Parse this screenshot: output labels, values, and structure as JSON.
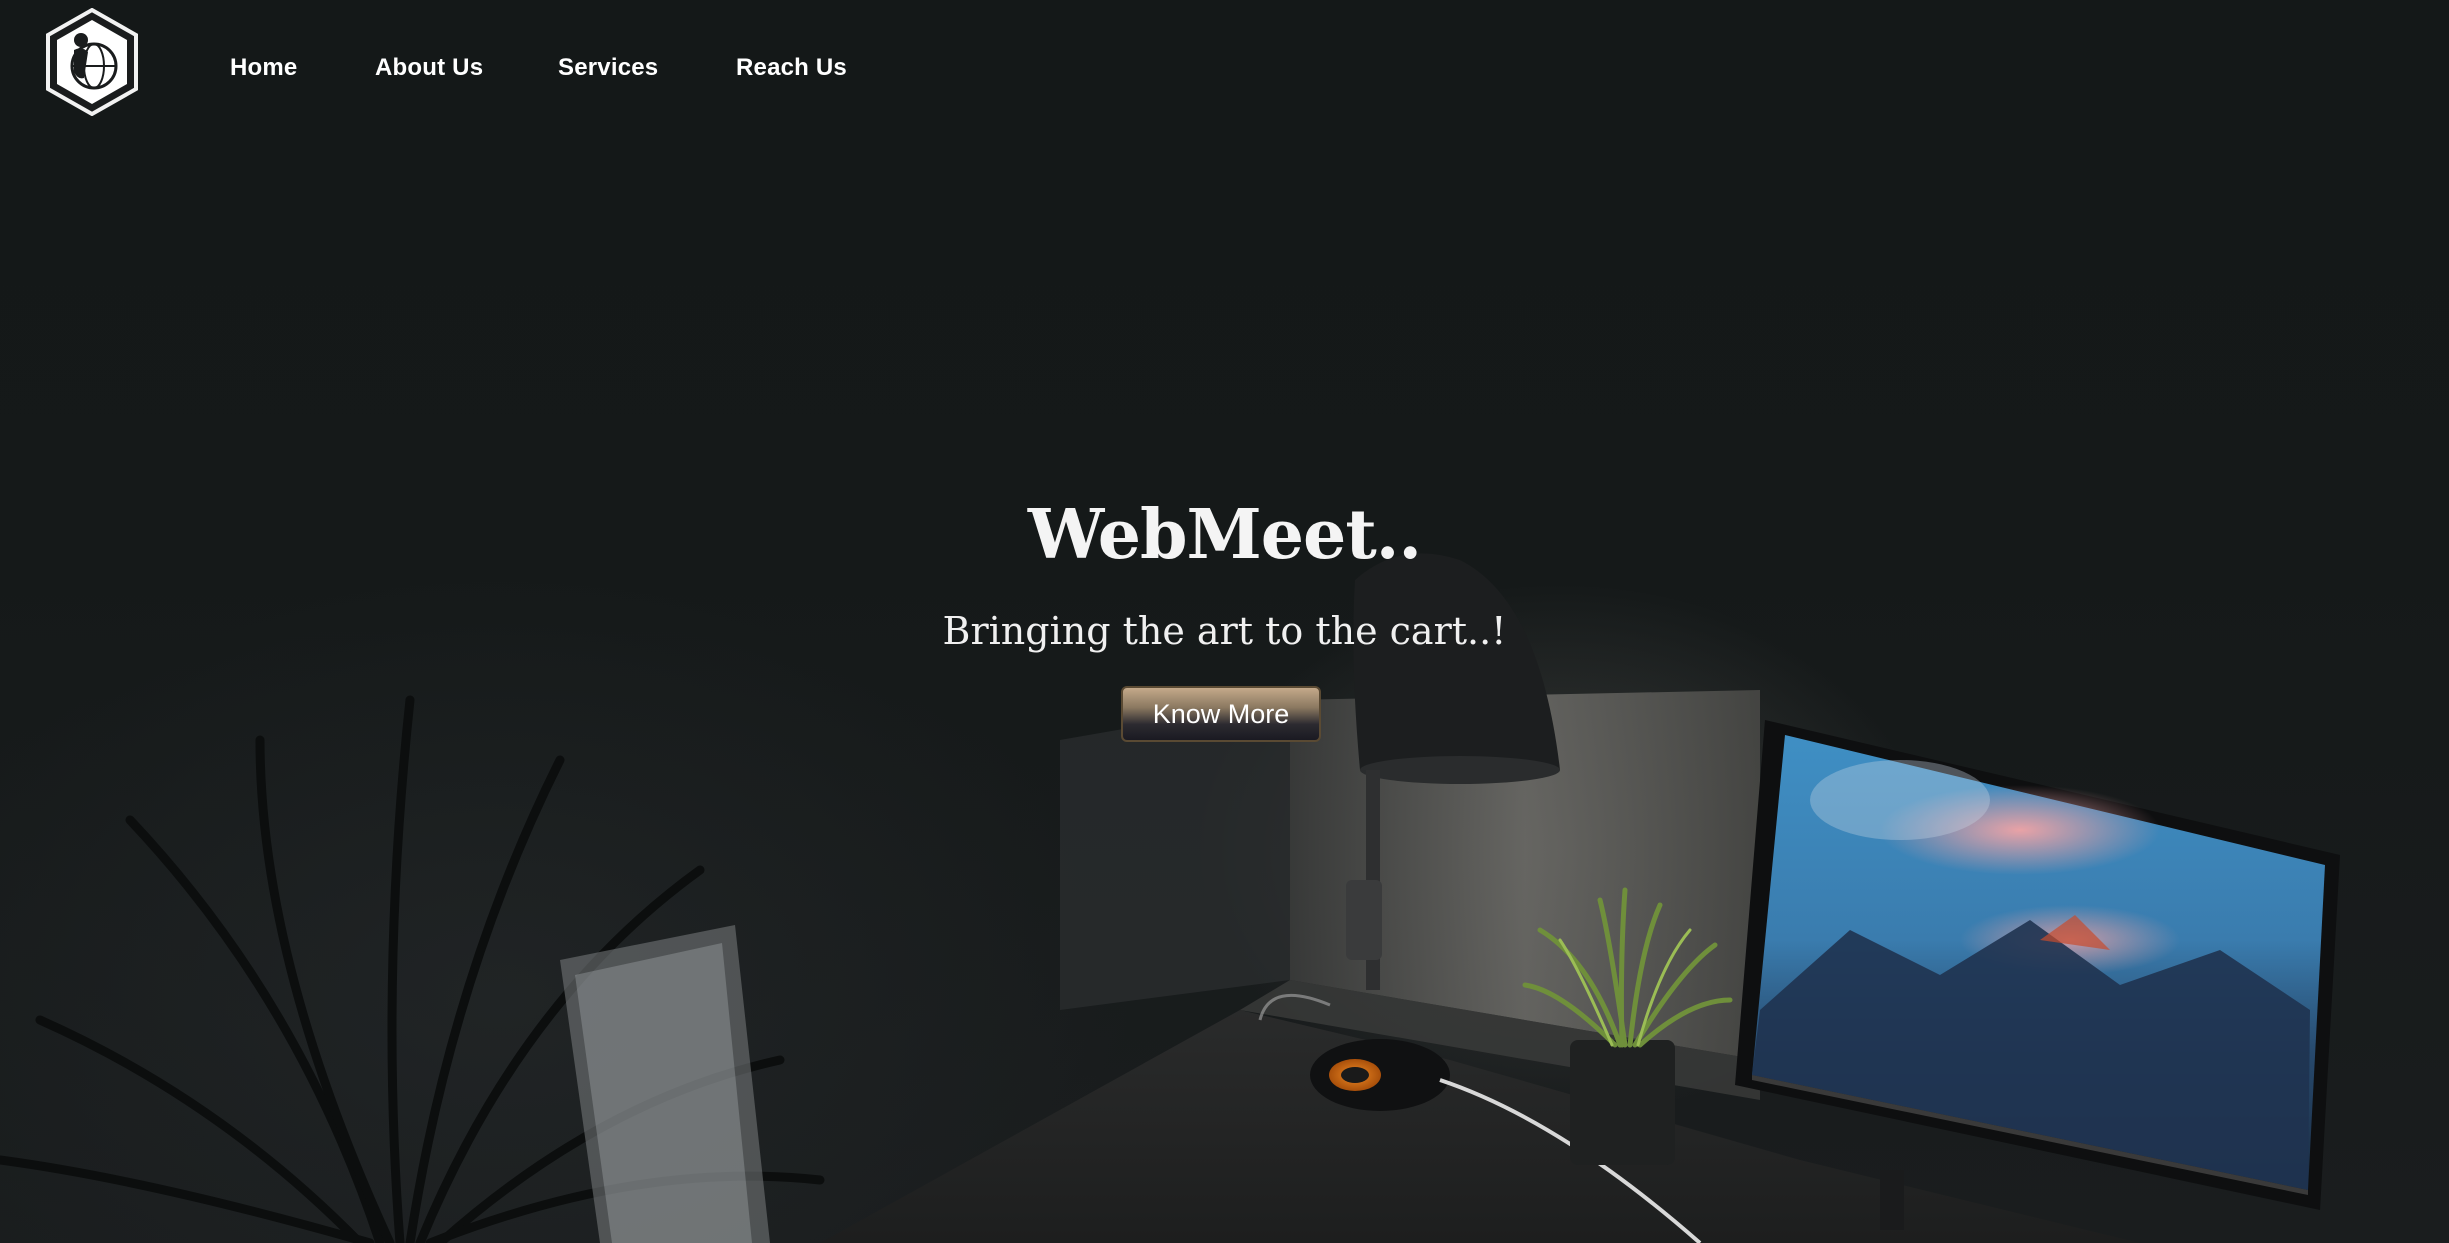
{
  "nav": {
    "logo_icon": "globe-person-hexagon-icon",
    "links": [
      {
        "label": "Home"
      },
      {
        "label": "About Us"
      },
      {
        "label": "Services"
      },
      {
        "label": "Reach Us"
      }
    ]
  },
  "hero": {
    "title": "WebMeet..",
    "subtitle": "Bringing the art to the cart..!",
    "button_label": "Know More",
    "background_image": "dark-desk-scene-with-lamp-plant-and-monitor"
  },
  "colors": {
    "background": "#141718",
    "text": "#ffffff",
    "button_top": "#c4a98a",
    "button_bottom": "#1a1a22"
  }
}
